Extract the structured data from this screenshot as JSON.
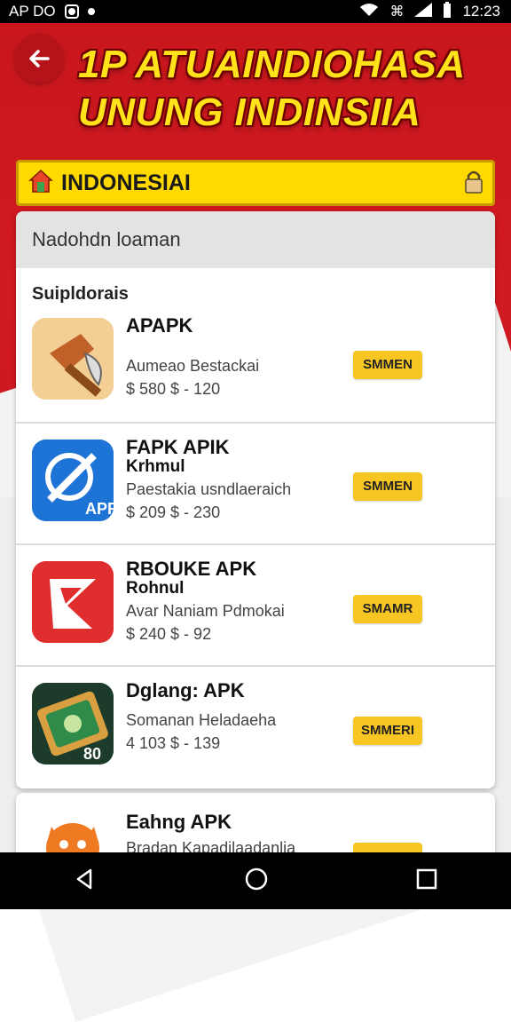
{
  "status_bar": {
    "left_text": "AP DO",
    "time": "12:23"
  },
  "header": {
    "title_line1": "1P ATUAINDIOHASA",
    "title_line2": "UNUNG INDINSIIA"
  },
  "country_bar": {
    "label": "INDONESIAI"
  },
  "search": {
    "text": "Nadohdn loaman"
  },
  "section": {
    "title": "Suipldorais"
  },
  "apps": [
    {
      "name": "APAPK",
      "sub": "",
      "desc": "Aumeao Bestackai",
      "price": "$ 580 $ - 120",
      "button": "SMMEN",
      "icon": "hammer-icon",
      "color": "#d8a060"
    },
    {
      "name": "FAPK APIK",
      "sub": "Krhmul",
      "desc": "Paestakia usndlaeraich",
      "price": "$ 209 $ - 230",
      "button": "SMMEN",
      "icon": "tool-icon",
      "color": "#1e73d6"
    },
    {
      "name": "RBOUKE APK",
      "sub": "Rohnul",
      "desc": "Avar Naniam Pdmokai",
      "price": "$ 240 $ - 92",
      "button": "SMAMR",
      "icon": "flag-icon",
      "color": "#e02d2d"
    },
    {
      "name": "Dglang: APK",
      "sub": "",
      "desc": "Somanan Heladaeha",
      "price": "4 103 $ - 139",
      "button": "SMMERI",
      "icon": "money-icon",
      "color": "#1f5c3a"
    },
    {
      "name": "Eahng APK",
      "sub": "",
      "desc": "Bradan Kapadilaadanlia",
      "price": "",
      "button": "",
      "icon": "monster-icon",
      "color": "#f07a22"
    }
  ],
  "colors": {
    "header_red": "#c8161d",
    "title_yellow": "#ffe21a",
    "country_yellow": "#ffd900",
    "button_yellow": "#f7c623"
  }
}
